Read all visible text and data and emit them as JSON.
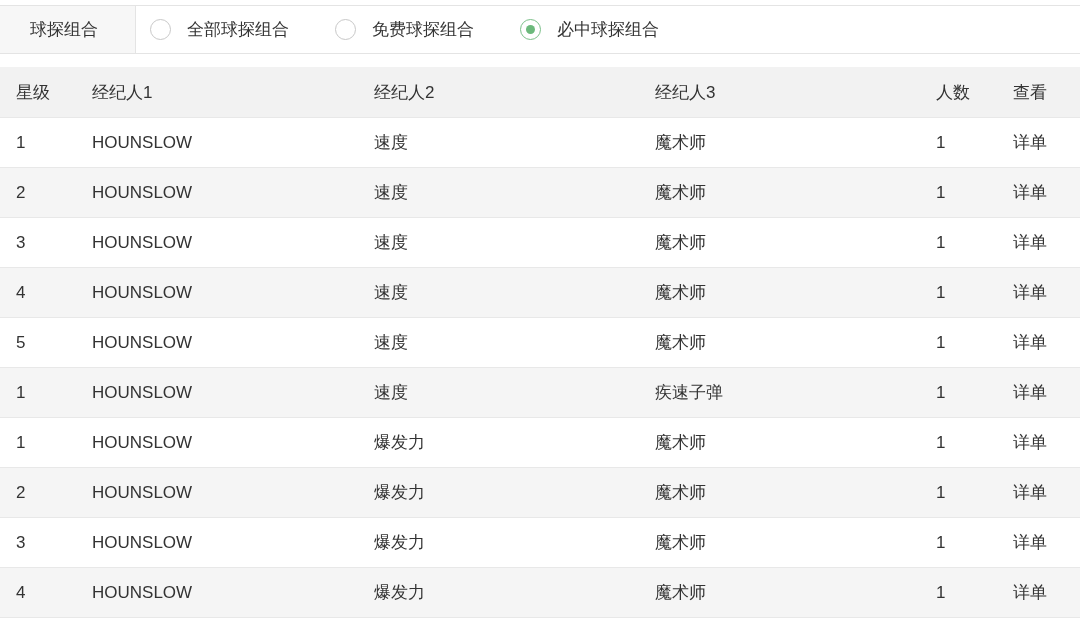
{
  "filter": {
    "label": "球探组合",
    "options": [
      {
        "label": "全部球探组合",
        "selected": false
      },
      {
        "label": "免费球探组合",
        "selected": false
      },
      {
        "label": "必中球探组合",
        "selected": true
      }
    ]
  },
  "table": {
    "columns": [
      "星级",
      "经纪人1",
      "经纪人2",
      "经纪人3",
      "人数",
      "查看"
    ],
    "rows": [
      {
        "cells": [
          "1",
          "HOUNSLOW",
          "速度",
          "魔术师",
          "1",
          "详单"
        ]
      },
      {
        "cells": [
          "2",
          "HOUNSLOW",
          "速度",
          "魔术师",
          "1",
          "详单"
        ]
      },
      {
        "cells": [
          "3",
          "HOUNSLOW",
          "速度",
          "魔术师",
          "1",
          "详单"
        ]
      },
      {
        "cells": [
          "4",
          "HOUNSLOW",
          "速度",
          "魔术师",
          "1",
          "详单"
        ]
      },
      {
        "cells": [
          "5",
          "HOUNSLOW",
          "速度",
          "魔术师",
          "1",
          "详单"
        ]
      },
      {
        "cells": [
          "1",
          "HOUNSLOW",
          "速度",
          "疾速子弹",
          "1",
          "详单"
        ]
      },
      {
        "cells": [
          "1",
          "HOUNSLOW",
          "爆发力",
          "魔术师",
          "1",
          "详单"
        ]
      },
      {
        "cells": [
          "2",
          "HOUNSLOW",
          "爆发力",
          "魔术师",
          "1",
          "详单"
        ]
      },
      {
        "cells": [
          "3",
          "HOUNSLOW",
          "爆发力",
          "魔术师",
          "1",
          "详单"
        ]
      },
      {
        "cells": [
          "4",
          "HOUNSLOW",
          "爆发力",
          "魔术师",
          "1",
          "详单"
        ]
      }
    ]
  }
}
